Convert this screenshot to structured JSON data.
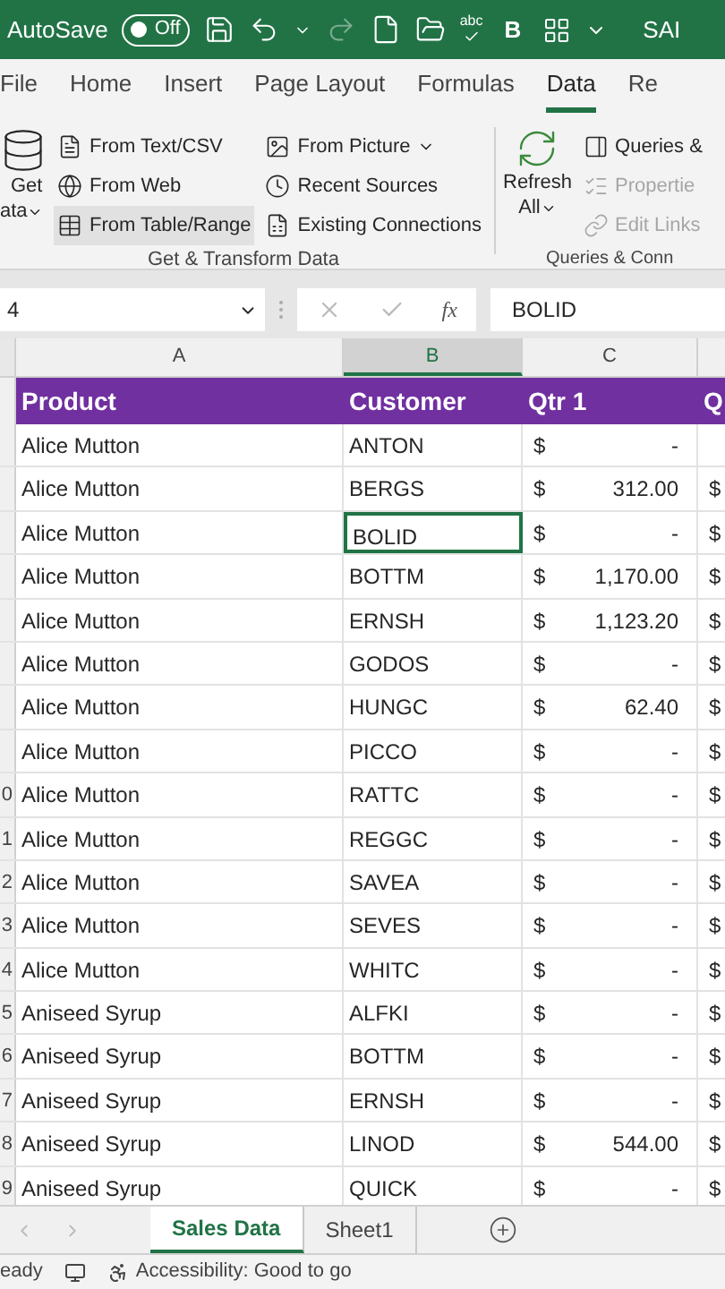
{
  "title_bar": {
    "autosave_label": "AutoSave",
    "autosave_toggle": {
      "label": "Off",
      "on": false
    },
    "bold_label": "B",
    "spell_label": "abc",
    "file_name": "SAI"
  },
  "ribbon_tabs": [
    {
      "label": "File",
      "selected": false
    },
    {
      "label": "Home",
      "selected": false
    },
    {
      "label": "Insert",
      "selected": false
    },
    {
      "label": "Page Layout",
      "selected": false
    },
    {
      "label": "Formulas",
      "selected": false
    },
    {
      "label": "Data",
      "selected": true
    },
    {
      "label": "Re",
      "selected": false
    }
  ],
  "ribbon": {
    "get_data": [
      "Get",
      "ata"
    ],
    "commands_col1": [
      {
        "label": "From Text/CSV",
        "hover": false
      },
      {
        "label": "From Web",
        "hover": false
      },
      {
        "label": "From Table/Range",
        "hover": true
      }
    ],
    "commands_col2": [
      {
        "label": "From Picture",
        "dropdown": true
      },
      {
        "label": "Recent Sources",
        "dropdown": false
      },
      {
        "label": "Existing Connections",
        "dropdown": false
      }
    ],
    "group1_label": "Get & Transform Data",
    "refresh": [
      "Refresh",
      "All"
    ],
    "commands_col3": [
      {
        "label": "Queries &",
        "disabled": false
      },
      {
        "label": "Propertie",
        "disabled": true
      },
      {
        "label": "Edit Links",
        "disabled": true
      }
    ],
    "group2_label": "Queries & Conn"
  },
  "formula_bar": {
    "name_box": "4",
    "fx_label": "fx",
    "value": "BOLID"
  },
  "columns": [
    {
      "label": "A",
      "selected": false
    },
    {
      "label": "B",
      "selected": true
    },
    {
      "label": "C",
      "selected": false
    }
  ],
  "header_row": [
    "Product",
    "Customer",
    "Qtr 1",
    "Q"
  ],
  "rows": [
    {
      "row_number": "",
      "product": "Alice Mutton",
      "customer": "ANTON",
      "currency": "$",
      "qtr1": "-",
      "next": "",
      "selected": false
    },
    {
      "row_number": "",
      "product": "Alice Mutton",
      "customer": "BERGS",
      "currency": "$",
      "qtr1": "312.00",
      "next": "$",
      "selected": false
    },
    {
      "row_number": "",
      "product": "Alice Mutton",
      "customer": "BOLID",
      "currency": "$",
      "qtr1": "-",
      "next": "$",
      "selected": true
    },
    {
      "row_number": "",
      "product": "Alice Mutton",
      "customer": "BOTTM",
      "currency": "$",
      "qtr1": "1,170.00",
      "next": "$",
      "selected": false
    },
    {
      "row_number": "",
      "product": "Alice Mutton",
      "customer": "ERNSH",
      "currency": "$",
      "qtr1": "1,123.20",
      "next": "$",
      "selected": false
    },
    {
      "row_number": "",
      "product": "Alice Mutton",
      "customer": "GODOS",
      "currency": "$",
      "qtr1": "-",
      "next": "$",
      "selected": false
    },
    {
      "row_number": "",
      "product": "Alice Mutton",
      "customer": "HUNGC",
      "currency": "$",
      "qtr1": "62.40",
      "next": "$",
      "selected": false
    },
    {
      "row_number": "",
      "product": "Alice Mutton",
      "customer": "PICCO",
      "currency": "$",
      "qtr1": "-",
      "next": "$",
      "selected": false
    },
    {
      "row_number": "0",
      "product": "Alice Mutton",
      "customer": "RATTC",
      "currency": "$",
      "qtr1": "-",
      "next": "$",
      "selected": false
    },
    {
      "row_number": "1",
      "product": "Alice Mutton",
      "customer": "REGGC",
      "currency": "$",
      "qtr1": "-",
      "next": "$",
      "selected": false
    },
    {
      "row_number": "2",
      "product": "Alice Mutton",
      "customer": "SAVEA",
      "currency": "$",
      "qtr1": "-",
      "next": "$",
      "selected": false
    },
    {
      "row_number": "3",
      "product": "Alice Mutton",
      "customer": "SEVES",
      "currency": "$",
      "qtr1": "-",
      "next": "$",
      "selected": false
    },
    {
      "row_number": "4",
      "product": "Alice Mutton",
      "customer": "WHITC",
      "currency": "$",
      "qtr1": "-",
      "next": "$",
      "selected": false
    },
    {
      "row_number": "5",
      "product": "Aniseed Syrup",
      "customer": "ALFKI",
      "currency": "$",
      "qtr1": "-",
      "next": "$",
      "selected": false
    },
    {
      "row_number": "6",
      "product": "Aniseed Syrup",
      "customer": "BOTTM",
      "currency": "$",
      "qtr1": "-",
      "next": "$",
      "selected": false
    },
    {
      "row_number": "7",
      "product": "Aniseed Syrup",
      "customer": "ERNSH",
      "currency": "$",
      "qtr1": "-",
      "next": "$",
      "selected": false
    },
    {
      "row_number": "8",
      "product": "Aniseed Syrup",
      "customer": "LINOD",
      "currency": "$",
      "qtr1": "544.00",
      "next": "$",
      "selected": false
    },
    {
      "row_number": "9",
      "product": "Aniseed Syrup",
      "customer": "QUICK",
      "currency": "$",
      "qtr1": "-",
      "next": "$",
      "selected": false
    }
  ],
  "sheet_tabs": [
    {
      "label": "Sales Data",
      "selected": true
    },
    {
      "label": "Sheet1",
      "selected": false
    }
  ],
  "status_bar": {
    "mode": "eady",
    "accessibility": "Accessibility: Good to go"
  }
}
